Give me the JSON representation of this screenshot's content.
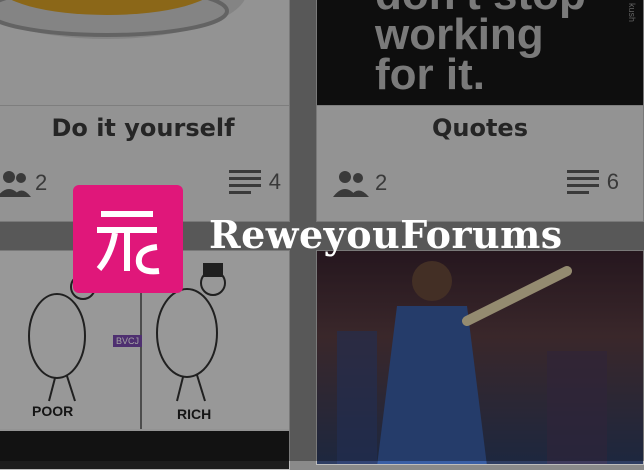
{
  "cards": [
    {
      "title": "Do it yourself",
      "members": "2",
      "posts": "4"
    },
    {
      "title": "Quotes",
      "members": "2",
      "posts": "6",
      "image_text": "don't stop\nworking\nfor it.",
      "watermark": "kush"
    },
    {
      "cartoon_labels": [
        "POOR",
        "RICH"
      ],
      "badge": "BVCJ"
    }
  ],
  "splash": {
    "brand_name": "ReweyouForums"
  },
  "colors": {
    "brand": "#e0177a",
    "overlay": "#000000"
  },
  "icons": {
    "members": "people-icon",
    "posts": "list-lines-icon"
  }
}
